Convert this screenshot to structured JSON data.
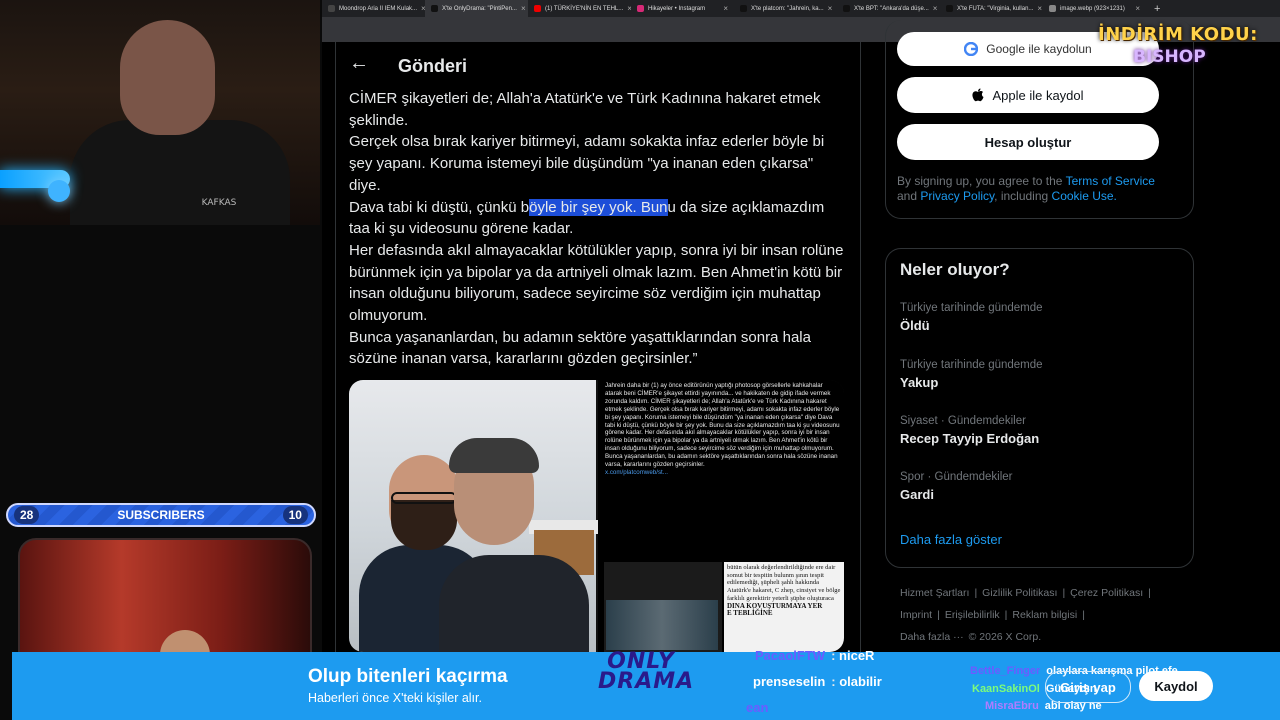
{
  "browser": {
    "tabs": [
      {
        "label": "Moondrop Aria II IEM Kulak...",
        "color": "#444"
      },
      {
        "label": "X'te OnlyDrama: \"PintiPen...",
        "color": "#111",
        "active": true
      },
      {
        "label": "(1) TÜRKİYE'NİN EN TEHL...",
        "color": "#e00"
      },
      {
        "label": "Hikayeler • Instagram",
        "color": "#d62976"
      },
      {
        "label": "X'te platcom: \"Jahrein, ka...",
        "color": "#111"
      },
      {
        "label": "X'te BPT: \"Ankara'da düşe...",
        "color": "#111"
      },
      {
        "label": "X'te FUTA: \"Virginia, kullan...",
        "color": "#111"
      },
      {
        "label": "image.webp (923×1231)",
        "color": "#888"
      }
    ],
    "new_tab": "+"
  },
  "stream": {
    "subscribers_label": "SUBSCRIBERS",
    "sub_left": "28",
    "sub_right": "10",
    "logo_text": "KAFKAS"
  },
  "promo": {
    "line1": "İNDİRİM KODU:",
    "line2": "BISHOP"
  },
  "post": {
    "header_title": "Gönderi",
    "back_icon": "←",
    "paragraphs": [
      {
        "pre": "CİMER şikayetleri de; Allah'a Atatürk'e ve Türk Kadınına hakaret etmek şeklinde.",
        "hl": "",
        "post": ""
      },
      {
        "pre": "Gerçek olsa bırak kariyer bitirmeyi, adamı sokakta infaz ederler böyle bi şey yapanı. Koruma istemeyi bile düşündüm \"ya inanan eden çıkarsa\" diye.",
        "hl": "",
        "post": ""
      },
      {
        "pre": "Dava tabi ki düştü, çünkü b",
        "hl": "öyle bir şey yok. Bun",
        "post": "u da size açıklamazdım taa ki şu videosunu görene kadar."
      },
      {
        "pre": "Her defasında akıl almayacaklar kötülükler yapıp, sonra iyi bir insan rolüne bürünmek için ya bipolar ya da artniyeli olmak lazım. Ben Ahmet'in kötü bir insan olduğunu biliyorum, sadece seyircime söz verdiğim için muhattap olmuyorum.",
        "hl": "",
        "post": ""
      },
      {
        "pre": "Bunca yaşananlardan, bu adamın sektöre yaşattıklarından sonra hala sözüne inanan varsa, kararlarını gözden geçirsinler.”",
        "hl": "",
        "post": ""
      }
    ],
    "media": {
      "screenshot_text": "Jahrein daha bir (1) ay önce editörünün yaptığı photosop görsellerle kahkahalar atarak beni CİMER'e şikayet ettirdi yayınında... ve hakikaten de gidip ifade vermek zorunda kaldım. CİMER şikayetleri de; Allah'a Atatürk'e ve Türk Kadınına hakaret etmek şeklinde. Gerçek olsa bırak kariyer bitirmeyi, adamı sokakta infaz ederler böyle bi şey yapanı. Koruma istemeyi bile düşündüm \"ya inanan eden çıkarsa\" diye Dava tabi ki düştü, çünkü böyle bir şey yok. Bunu da size açıklamazdım taa ki şu videosunu görene kadar. Her defasında akıl almayacaklar kötülükler yapıp, sonra iyi bir insan rolüne bürünmek için ya bipolar ya da artniyeli olmak lazım. Ben Ahmet'in kötü bir insan olduğunu biliyorum, sadece seyircime söz verdiğim için muhattap olmuyorum. Bunca yaşananlardan, bu adamın sektöre yaşattıklarından sonra hala sözüne inanan varsa, kararlarını gözden geçirsinler.",
      "screenshot_link": "x.com/platcomweb/st...",
      "doc_text": "bütün olarak değerlendirildiğinde ere dair somut bir tespitin bulunm şının tespit edilemediği, şüpheli şahlı hakkında Atatürk'e hakaret, C zhep, cinsiyet ve bölge farklılı gerektirir yeterli şüphe oluşturaca",
      "doc_heading": "DINA KOVUŞTURMAYA YER",
      "doc_footer": "E TEBLİĞİNE"
    }
  },
  "sidebar": {
    "google_btn": "Google ile kaydolun",
    "apple_btn": "Apple ile kaydol",
    "create_btn": "Hesap oluştur",
    "legal_pre": "By signing up, you agree to the ",
    "legal_tos": "Terms of Service",
    "legal_and": " and ",
    "legal_privacy": "Privacy Policy",
    "legal_incl": ", including ",
    "legal_cookie": "Cookie Use.",
    "trends_title": "Neler oluyor?",
    "trends": [
      {
        "category": "Türkiye tarihinde gündemde",
        "name": "Öldü"
      },
      {
        "category": "Türkiye tarihinde gündemde",
        "name": "Yakup"
      },
      {
        "category": "Siyaset · Gündemdekiler",
        "name": "Recep Tayyip Erdoğan"
      },
      {
        "category": "Spor · Gündemdekiler",
        "name": "Gardi"
      }
    ],
    "show_more": "Daha fazla göster",
    "footer": [
      "Hizmet Şartları",
      "|",
      "Gizlilik Politikası",
      "|",
      "Çerez Politikası",
      "|",
      "Imprint",
      "|",
      "Erişilebilirlik",
      "|",
      "Reklam bilgisi",
      "|",
      "Daha fazla ···",
      "© 2026 X Corp."
    ]
  },
  "banner": {
    "title": "Olup bitenleri kaçırma",
    "subtitle": "Haberleri önce X'teki kişiler alır.",
    "login_btn": "Giriş yap",
    "signup_btn": "Kaydol",
    "logo_line1": "ONLY",
    "logo_line2": "DRAMA"
  },
  "chat": [
    {
      "user": "PacaolFTW",
      "msg": "niceR",
      "ucolor": "#6b5cff",
      "mcolor": "#fff"
    },
    {
      "user": "prenseselin",
      "msg": "olabilir",
      "ucolor": "#fff",
      "mcolor": "#fff"
    },
    {
      "user": "ean",
      "msg": "",
      "ucolor": "#6b5cff",
      "mcolor": "#fff"
    },
    {
      "user": "Bettle_Finger",
      "msg": "olaylara karışma pilot efe",
      "ucolor": "#6b5cff",
      "mcolor": "#fff"
    },
    {
      "user": "KaanSakinOl",
      "msg": "Günaydın",
      "ucolor": "#7cfc7c",
      "mcolor": "#fff"
    },
    {
      "user": "MisraEbru",
      "msg": "abi olay ne",
      "ucolor": "#b07cff",
      "mcolor": "#fff"
    }
  ],
  "colors": {
    "x_blue": "#1d9bf0",
    "highlight": "#1d4ed8"
  }
}
